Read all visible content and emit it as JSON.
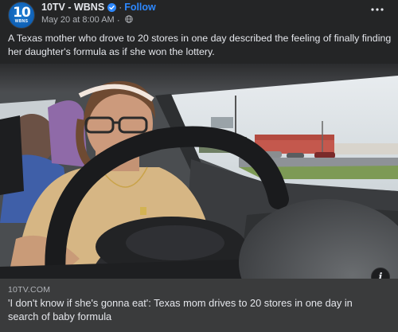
{
  "post": {
    "page_name": "10TV - WBNS",
    "follow_label": "Follow",
    "timestamp": "May 20 at 8:00 AM",
    "separator": "·",
    "avatar": {
      "number": "10",
      "call_sign": "WBNS",
      "color": "#1f7fd6"
    },
    "verified_icon": "verified-badge-icon",
    "audience_icon": "globe-icon",
    "more_icon": "more-horizontal-icon",
    "caption": "A Texas mother who drove to 20 stores in one day described the feeling of finally finding her daughter's formula as if she won the lottery."
  },
  "photo": {
    "info_icon": "i"
  },
  "link_card": {
    "domain": "10TV.COM",
    "headline": "'I don't know if she's gonna eat': Texas mom drives to 20 stores in one day in search of baby formula"
  },
  "colors": {
    "background": "#242526",
    "link_card": "#3a3b3c",
    "accent": "#2d88ff",
    "text_primary": "#e4e6eb",
    "text_secondary": "#b0b3b8"
  }
}
